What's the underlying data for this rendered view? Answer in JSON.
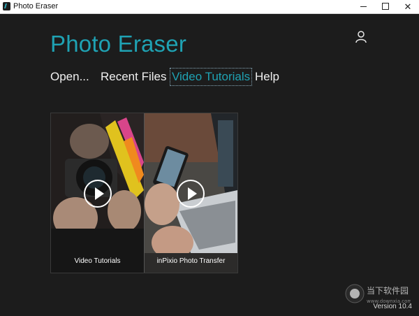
{
  "window": {
    "title": "Photo Eraser",
    "controls": [
      "minimize",
      "maximize",
      "close"
    ]
  },
  "app": {
    "title": "Photo Eraser",
    "user_icon": "user-icon",
    "accent": "#1fa2b3"
  },
  "nav": {
    "items": [
      {
        "label": "Open..."
      },
      {
        "label": "Recent Files"
      },
      {
        "label": "Video Tutorials",
        "active": true
      },
      {
        "label": "Help"
      }
    ]
  },
  "tiles": [
    {
      "label": "Video Tutorials",
      "icon": "play-icon"
    },
    {
      "label": "inPixio Photo Transfer",
      "icon": "play-icon"
    }
  ],
  "footer": {
    "version": "Version 10.4"
  },
  "watermark": {
    "text": "当下软件园",
    "url": "www.downxia.com"
  }
}
